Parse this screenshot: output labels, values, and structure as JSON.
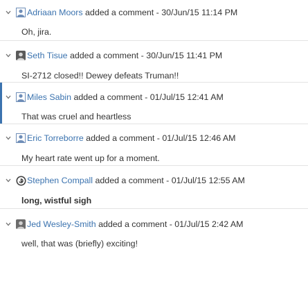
{
  "comments": [
    {
      "author": "Adriaan Moors",
      "action": "added a comment",
      "separator": " - ",
      "timestamp": "30/Jun/15 11:14 PM",
      "body": "Oh, jira.",
      "avatar_icon": "user-silhouette-icon"
    },
    {
      "author": "Seth Tisue",
      "action": "added a comment",
      "separator": " - ",
      "timestamp": "30/Jun/15 11:41 PM",
      "body": "SI-2712 closed!! Dewey defeats Truman!!",
      "avatar_icon": "photo-avatar-icon"
    },
    {
      "author": "Miles Sabin",
      "action": "added a comment",
      "separator": " - ",
      "timestamp": "01/Jul/15 12:41 AM",
      "body": "That was cruel and heartless",
      "avatar_icon": "user-silhouette-icon"
    },
    {
      "author": "Eric Torreborre",
      "action": "added a comment",
      "separator": " - ",
      "timestamp": "01/Jul/15 12:46 AM",
      "body": "My heart rate went up for a moment.",
      "avatar_icon": "user-silhouette-icon"
    },
    {
      "author": "Stephen Compall",
      "action": "added a comment",
      "separator": " - ",
      "timestamp": "01/Jul/15 12:55 AM",
      "body": "long, wistful sigh",
      "avatar_icon": "gravatar-icon"
    },
    {
      "author": "Jed Wesley-Smith",
      "action": "added a comment",
      "separator": " - ",
      "timestamp": "01/Jul/15 2:42 AM",
      "body": "well, that was (briefly) exciting!",
      "avatar_icon": "photo-avatar-icon"
    }
  ],
  "colors": {
    "link": "#3b73af",
    "text": "#333333",
    "divider": "#e3e3e3",
    "focus_bar": "#3b73af"
  }
}
